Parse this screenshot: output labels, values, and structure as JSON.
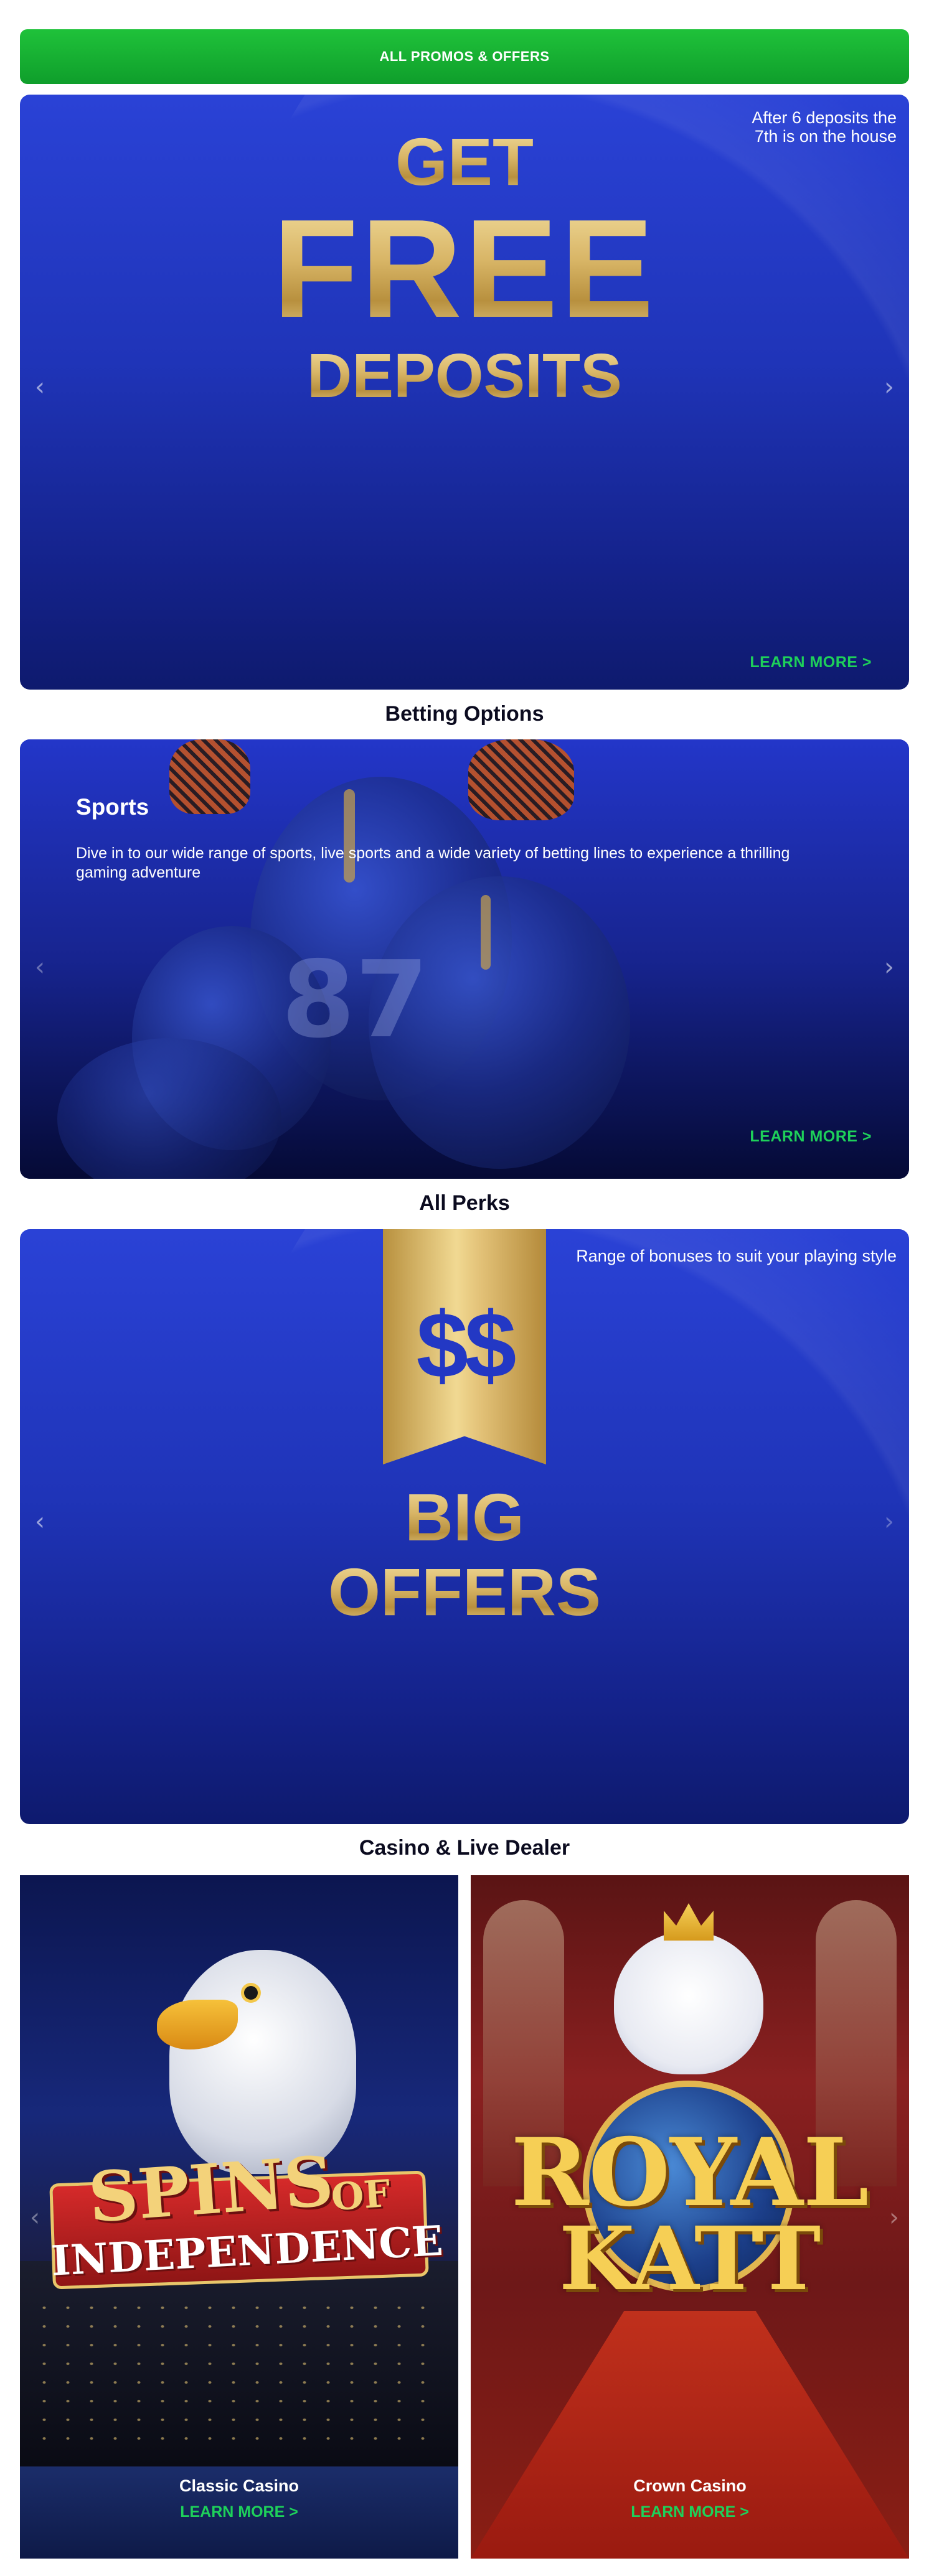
{
  "promo_button": {
    "label": "ALL PROMOS & OFFERS"
  },
  "hero": {
    "corner_text": "After 6 deposits the 7th is on the house",
    "headline_top": "GET",
    "headline_main": "FREE",
    "headline_bottom": "DEPOSITS",
    "learn_more": "LEARN MORE >",
    "prev_icon": "chevron-left",
    "next_icon": "chevron-right"
  },
  "betting": {
    "section_title": "Betting Options",
    "card_title": "Sports",
    "card_description": "Dive in to our wide range of sports, live sports and a wide variety of betting lines to experience a thrilling gaming adventure",
    "jersey_number": "87",
    "learn_more": "LEARN MORE >"
  },
  "perks": {
    "section_title": "All Perks",
    "corner_text": "Range of bonuses to suit your playing style",
    "ribbon_text": "$$",
    "headline_top": "BIG",
    "headline_bottom": "OFFERS"
  },
  "casino": {
    "section_title": "Casino & Live Dealer",
    "tiles": [
      {
        "game_title_line1": "SPINS",
        "game_title_of": "OF",
        "game_title_line2": "INDEPENDENCE",
        "name": "Classic Casino",
        "learn_more": "LEARN MORE >"
      },
      {
        "game_title_line1": "ROYAL",
        "game_title_line2": "KATT",
        "name": "Crown Casino",
        "learn_more": "LEARN MORE >"
      }
    ]
  },
  "colors": {
    "promo_green": "#15b232",
    "learn_more_green": "#1ed05a",
    "card_blue": "#2a42d6",
    "gold": "#d8b566"
  }
}
